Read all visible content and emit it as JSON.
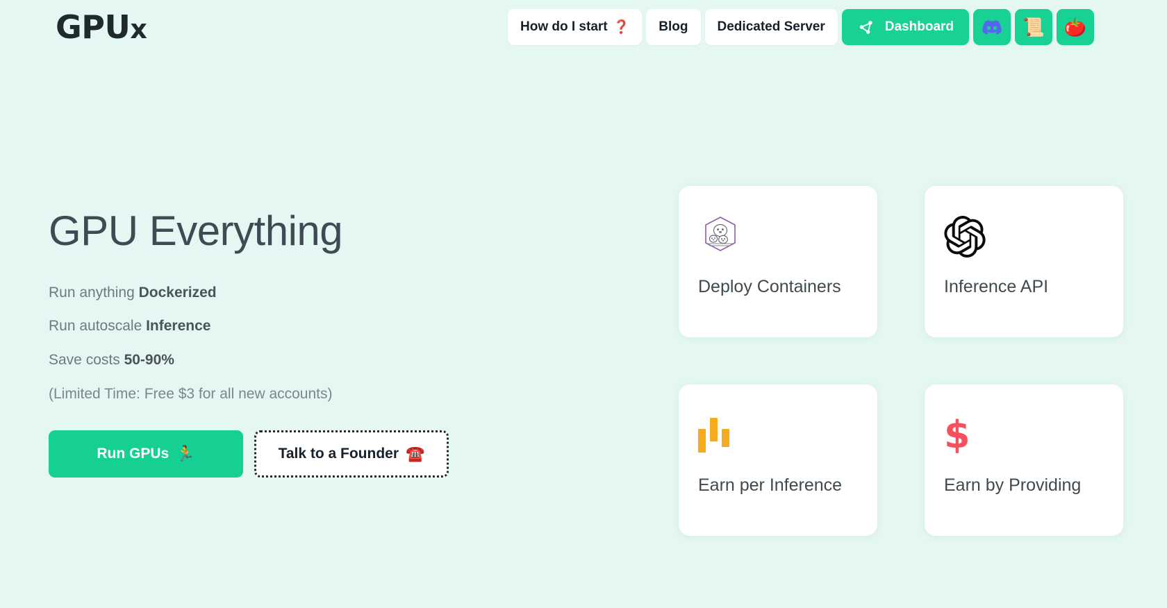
{
  "colors": {
    "background": "#e4f7f2",
    "accent_green": "#18d195",
    "card_bg": "#ffffff",
    "title_text": "#3f4a55",
    "muted_text": "#6f7a7d",
    "discord_purple": "#5865f2",
    "bar_orange": "#f6ab1e",
    "dollar_red": "#f4515e",
    "hex_purple": "#8e5ba6"
  },
  "header": {
    "logo": "GPUx",
    "logo_prefix": "GPU",
    "logo_suffix": "x",
    "nav": [
      {
        "id": "how-do-i-start",
        "label": "How do I start",
        "emoji": "❓",
        "style": "white"
      },
      {
        "id": "blog",
        "label": "Blog",
        "emoji": "",
        "style": "white"
      },
      {
        "id": "dedicated-server",
        "label": "Dedicated Server",
        "emoji": "",
        "style": "white"
      },
      {
        "id": "dashboard",
        "label": "Dashboard",
        "icon": "share-nodes-icon",
        "style": "primary"
      },
      {
        "id": "discord",
        "label": "",
        "icon": "discord-icon",
        "style": "icon-only"
      },
      {
        "id": "docs",
        "label": "",
        "emoji": "📜",
        "icon": "scroll-icon",
        "style": "icon-only"
      },
      {
        "id": "tomato",
        "label": "",
        "emoji": "🍅",
        "icon": "tomato-icon",
        "style": "icon-only"
      }
    ]
  },
  "hero": {
    "title": "GPU Everything",
    "bullets": [
      {
        "lead": "Run anything ",
        "strong": "Dockerized"
      },
      {
        "lead": "Run autoscale ",
        "strong": "Inference"
      },
      {
        "lead": "Save costs ",
        "strong": "50-90%"
      }
    ],
    "limited_time": "(Limited Time: Free $3 for all new accounts)",
    "cta_primary": {
      "label": "Run GPUs",
      "emoji": "🏃"
    },
    "cta_secondary": {
      "label": "Talk to a Founder",
      "emoji": "☎️"
    }
  },
  "cards": [
    {
      "id": "deploy-containers",
      "label": "Deploy Containers",
      "icon": "docker-moby-icon"
    },
    {
      "id": "inference-api",
      "label": "Inference API",
      "icon": "openai-icon"
    },
    {
      "id": "earn-per-inference",
      "label": "Earn per Inference",
      "icon": "bar-chart-icon"
    },
    {
      "id": "earn-by-providing",
      "label": "Earn by Providing",
      "icon": "dollar-sign-icon"
    }
  ]
}
